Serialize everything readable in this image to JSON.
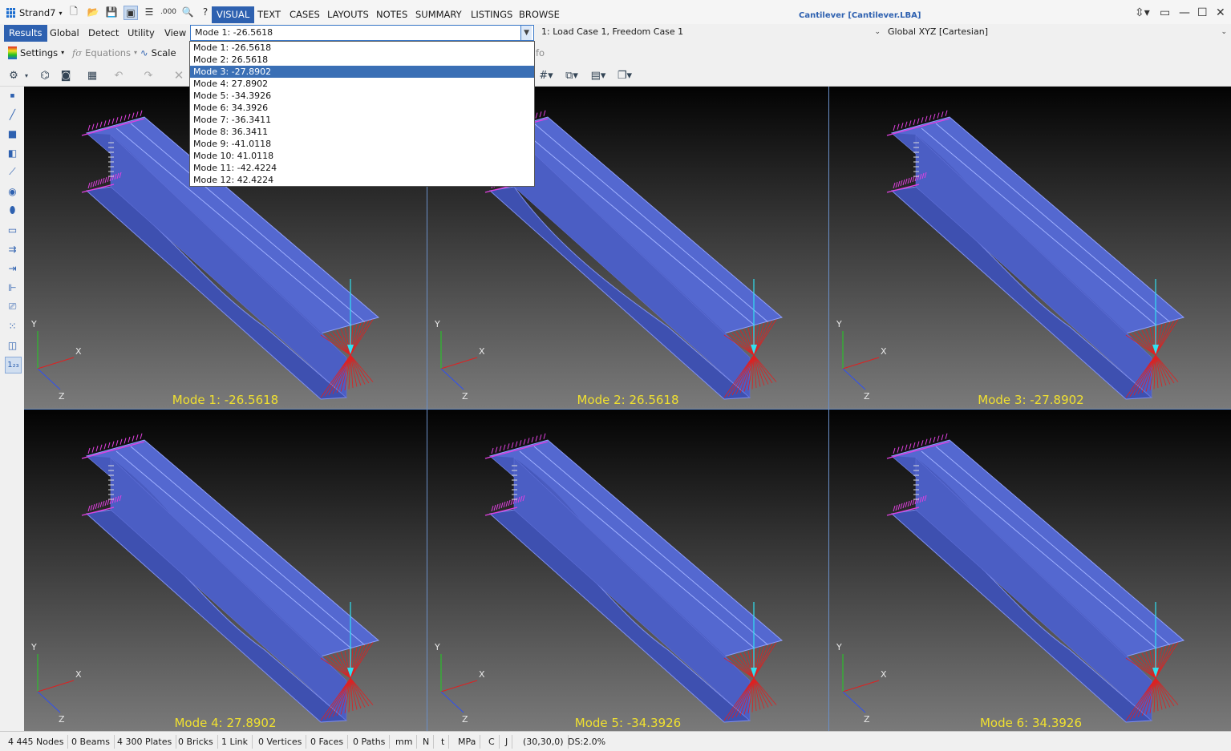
{
  "app": {
    "name": "Strand7",
    "window_title": "Cantilever [Cantilever.LBA]"
  },
  "tabs": [
    {
      "label": "VISUAL",
      "active": true
    },
    {
      "label": "TEXT"
    },
    {
      "label": "CASES"
    },
    {
      "label": "LAYOUTS"
    },
    {
      "label": "NOTES"
    },
    {
      "label": "SUMMARY"
    },
    {
      "label": "LISTINGS"
    },
    {
      "label": "BROWSE"
    }
  ],
  "menu": [
    "Results",
    "Global",
    "Detect",
    "Utility",
    "View"
  ],
  "mode_combo": {
    "value": "Mode 1: -26.5618"
  },
  "case_combo": {
    "value": "1: Load Case 1, Freedom Case 1"
  },
  "coord_combo": {
    "value": "Global XYZ [Cartesian]"
  },
  "toolbar": {
    "settings": "Settings",
    "equations": "Equations",
    "scale": "Scale",
    "info_fragment": "fo"
  },
  "dropdown": {
    "selected_index": 2,
    "items": [
      "Mode 1: -26.5618",
      "Mode 2: 26.5618",
      "Mode 3: -27.8902",
      "Mode 4: 27.8902",
      "Mode 5: -34.3926",
      "Mode 6: 34.3926",
      "Mode 7: -36.3411",
      "Mode 8: 36.3411",
      "Mode 9: -41.0118",
      "Mode 10: 41.0118",
      "Mode 11: -42.4224",
      "Mode 12: 42.4224"
    ]
  },
  "panels": [
    {
      "label": "Mode 1: -26.5618"
    },
    {
      "label": "Mode 2: 26.5618"
    },
    {
      "label": "Mode 3: -27.8902"
    },
    {
      "label": "Mode 4: 27.8902"
    },
    {
      "label": "Mode 5: -34.3926"
    },
    {
      "label": "Mode 6: 34.3926"
    }
  ],
  "axes": {
    "x": "X",
    "y": "Y",
    "z": "Z"
  },
  "colors": {
    "accent": "#2e61b0",
    "beam": "#4a5fc0",
    "mode_label": "#f0e030",
    "restraint": "#e040e0",
    "load": "#30e0f0"
  },
  "status": [
    "4 445 Nodes",
    "0 Beams",
    "4 300 Plates",
    "0 Bricks",
    "1 Link",
    "0 Vertices",
    "0 Faces",
    "0 Paths",
    "mm",
    "N",
    "t",
    "MPa",
    "C",
    "J",
    "(30,30,0)",
    "DS:2.0%"
  ]
}
